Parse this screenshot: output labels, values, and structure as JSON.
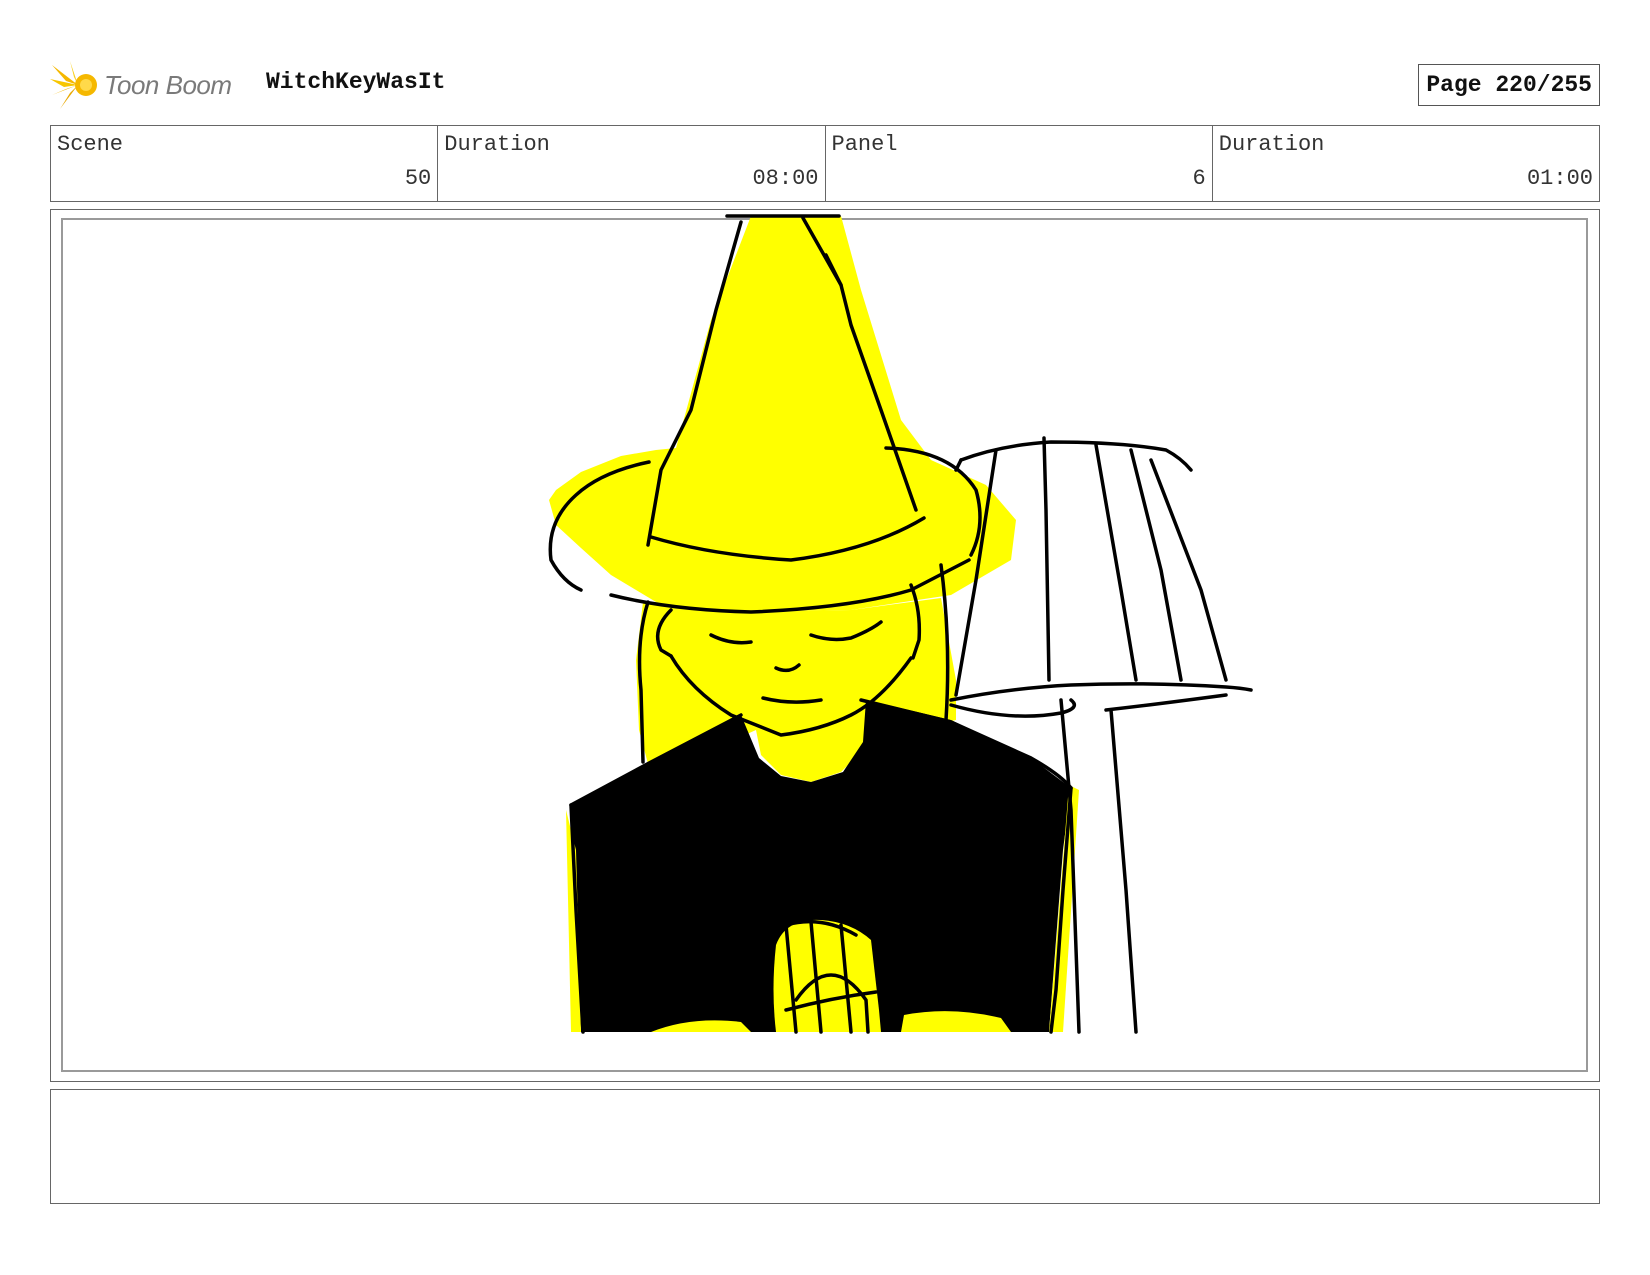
{
  "header": {
    "logo": {
      "icon": "toon-boom-logo-icon",
      "text": "Toon Boom",
      "brand_color": "#F5B800"
    },
    "project_title": "WitchKeyWasIt",
    "page_label": "Page 220/255"
  },
  "info": [
    {
      "label": "Scene",
      "value": "50"
    },
    {
      "label": "Duration",
      "value": "08:00"
    },
    {
      "label": "Panel",
      "value": "6"
    },
    {
      "label": "Duration",
      "value": "01:00"
    }
  ],
  "panel": {
    "colors": {
      "fill": "#FFFF00",
      "ink": "#000000"
    }
  },
  "notes": {
    "text": ""
  }
}
